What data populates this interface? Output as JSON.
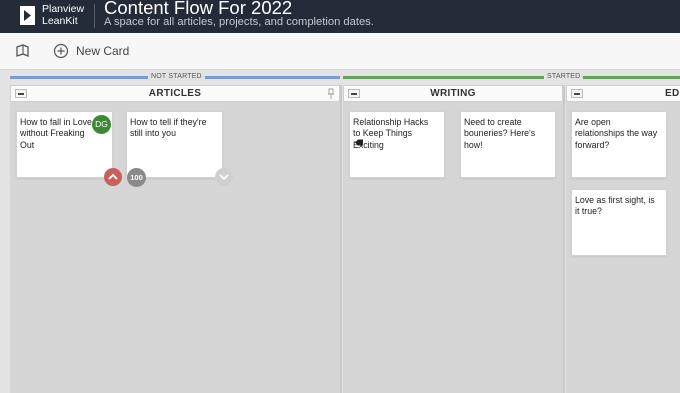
{
  "header": {
    "brand_line1": "Planview",
    "brand_line2": "LeanKit",
    "title": "Content Flow For 2022",
    "subtitle": "A space for all articles, projects, and completion dates."
  },
  "toolbar": {
    "new_card_label": "New Card"
  },
  "groups": [
    {
      "label": "NOT STARTED",
      "color": "#7a9ad6"
    },
    {
      "label": "STARTED",
      "color": "#64a35a"
    }
  ],
  "lanes": [
    {
      "title": "ARTICLES",
      "cards": [
        {
          "text": "How to fall in Love without Freaking Out",
          "avatar": "DG"
        },
        {
          "text": "How to tell if they're still into you",
          "badge": "100"
        }
      ]
    },
    {
      "title": "WRITING",
      "cards": [
        {
          "text": "Relationship Hacks to Keep Things Exciting"
        },
        {
          "text": "Need to create bouneries? Here's how!"
        }
      ]
    },
    {
      "title": "EDI",
      "cards": [
        {
          "text": "Are open relationships the way forward?"
        },
        {
          "text": "Love as first sight, is it true?"
        }
      ]
    }
  ],
  "colors": {
    "header_bg": "#232b38",
    "avatar_green": "#3b8a33",
    "scroll_up_red": "#c9605c",
    "badge_gray": "#8a8a8a"
  }
}
